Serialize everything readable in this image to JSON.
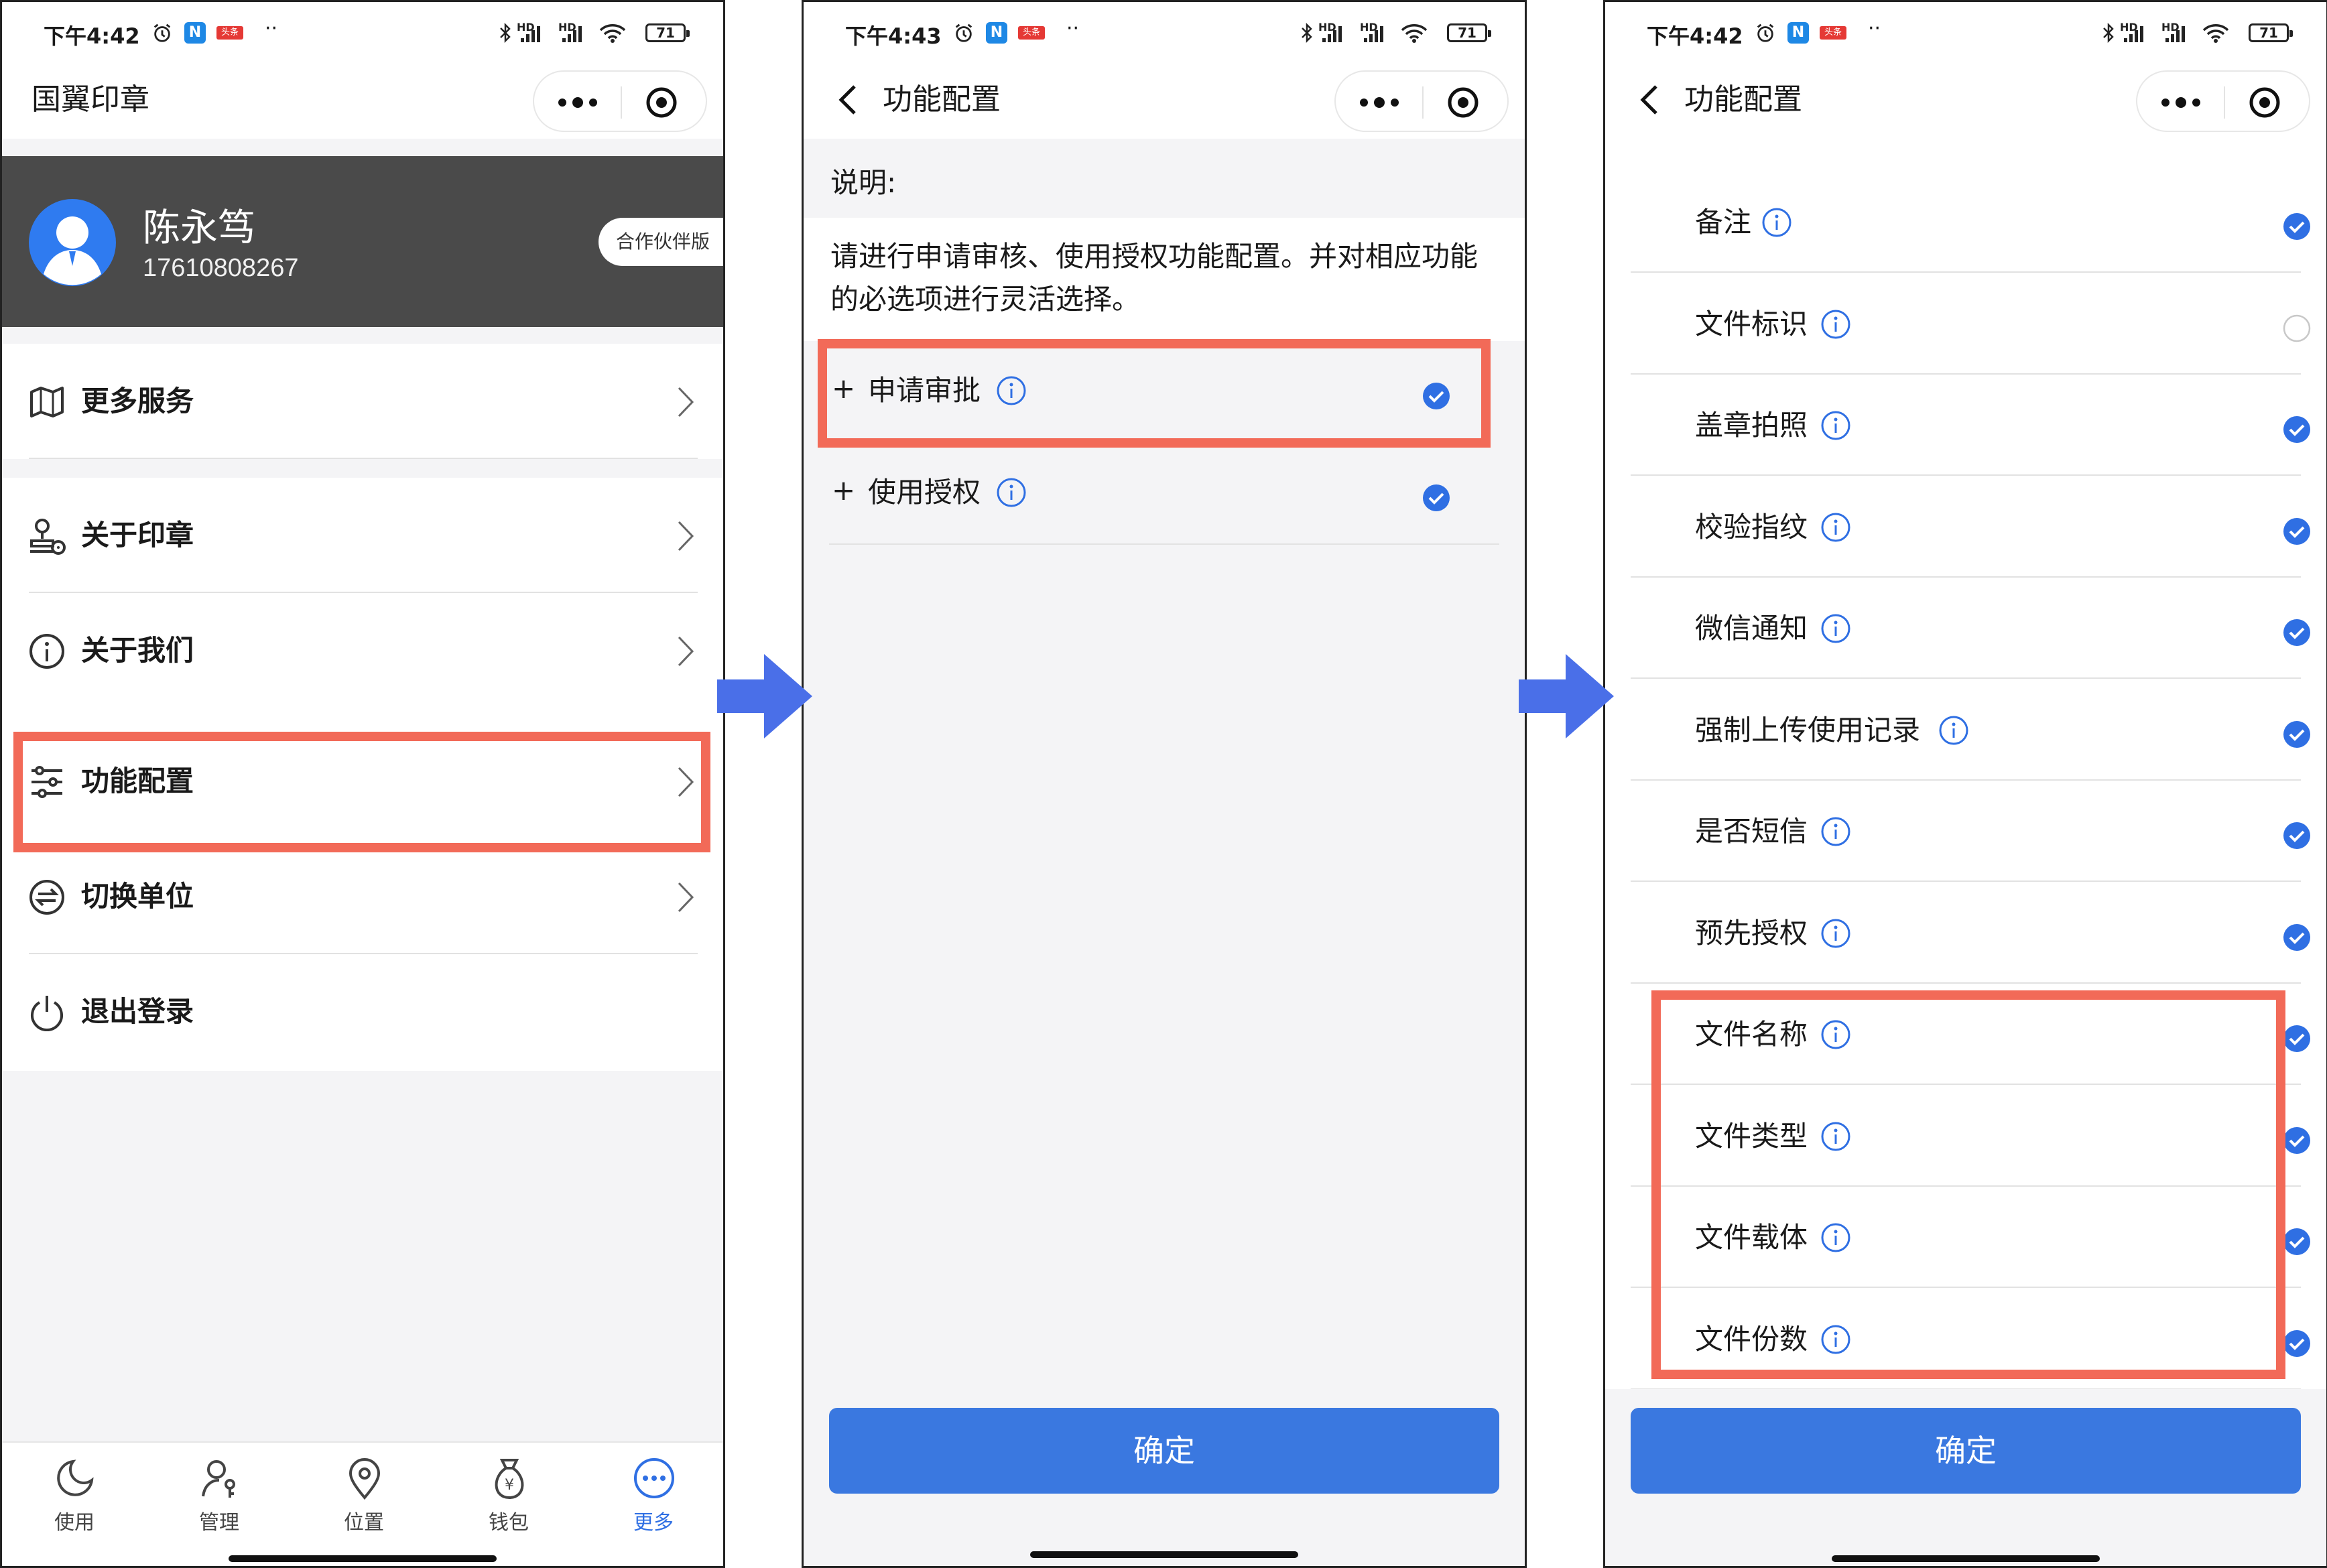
{
  "status": {
    "p1_time": "下午4:42",
    "p2_time": "下午4:43",
    "p3_time": "下午4:42",
    "battery": "71",
    "net_label": "HD",
    "toutiao_badge": "头条",
    "n_badge": "N"
  },
  "panel1": {
    "title": "国翼印章",
    "user": {
      "name": "陈永笃",
      "phone": "17610808267",
      "edition": "合作伙伴版"
    },
    "menu": [
      {
        "label": "更多服务",
        "icon": "map-icon"
      },
      {
        "label": "关于印章",
        "icon": "stamp-icon"
      },
      {
        "label": "关于我们",
        "icon": "info-icon"
      },
      {
        "label": "功能配置",
        "icon": "sliders-icon"
      },
      {
        "label": "切换单位",
        "icon": "switch-icon"
      },
      {
        "label": "退出登录",
        "icon": "power-icon"
      }
    ],
    "tabs": [
      {
        "label": "使用",
        "icon": "moon-icon"
      },
      {
        "label": "管理",
        "icon": "user-key-icon"
      },
      {
        "label": "位置",
        "icon": "location-icon"
      },
      {
        "label": "钱包",
        "icon": "money-bag-icon"
      },
      {
        "label": "更多",
        "icon": "more-circle-icon",
        "active": true
      }
    ]
  },
  "panel2": {
    "title": "功能配置",
    "desc_title": "说明:",
    "desc_text": "请进行申请审核、使用授权功能配置。并对相应功能的必选项进行灵活选择。",
    "items": [
      {
        "prefix": "+",
        "label": "申请审批",
        "checked": true
      },
      {
        "prefix": "+",
        "label": "使用授权",
        "checked": true
      }
    ],
    "confirm": "确定"
  },
  "panel3": {
    "title": "功能配置",
    "items": [
      {
        "label": "备注",
        "checked": true
      },
      {
        "label": "文件标识",
        "checked": false
      },
      {
        "label": "盖章拍照",
        "checked": true
      },
      {
        "label": "校验指纹",
        "checked": true
      },
      {
        "label": "微信通知",
        "checked": true
      },
      {
        "label": "强制上传使用记录",
        "checked": true
      },
      {
        "label": "是否短信",
        "checked": true
      },
      {
        "label": "预先授权",
        "checked": true
      },
      {
        "label": "文件名称",
        "checked": true
      },
      {
        "label": "文件类型",
        "checked": true
      },
      {
        "label": "文件载体",
        "checked": true
      },
      {
        "label": "文件份数",
        "checked": true
      }
    ],
    "confirm": "确定"
  },
  "colors": {
    "accent": "#3a78e0",
    "highlight": "#f26a58",
    "arrow": "#4a6fe8",
    "profile_bg": "#4a4a4a"
  }
}
